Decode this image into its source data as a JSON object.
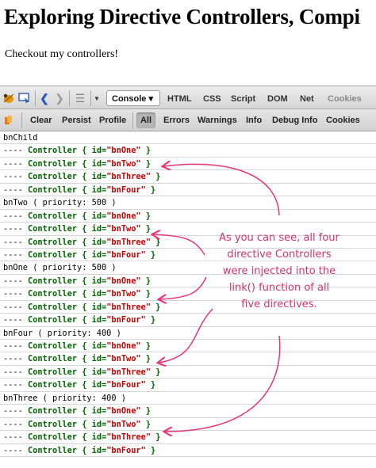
{
  "page": {
    "title": "Exploring Directive Controllers, Compi",
    "subtitle": "Checkout my controllers!"
  },
  "toolbar": {
    "console_tab": "Console ▾",
    "tabs": [
      "HTML",
      "CSS",
      "Script",
      "DOM",
      "Net",
      "Cookies"
    ]
  },
  "console_toolbar": {
    "buttons": [
      "Clear",
      "Persist",
      "Profile"
    ],
    "filters": [
      "All",
      "Errors",
      "Warnings",
      "Info",
      "Debug Info",
      "Cookies"
    ]
  },
  "log": [
    {
      "type": "header",
      "text": "bnChild"
    },
    {
      "type": "ctrl",
      "prefix": "----",
      "label": "Controller",
      "open": "{",
      "key": "id=",
      "value": "\"bnOne\"",
      "close": "}"
    },
    {
      "type": "ctrl",
      "prefix": "----",
      "label": "Controller",
      "open": "{",
      "key": "id=",
      "value": "\"bnTwo\"",
      "close": "}"
    },
    {
      "type": "ctrl",
      "prefix": "----",
      "label": "Controller",
      "open": "{",
      "key": "id=",
      "value": "\"bnThree\"",
      "close": "}"
    },
    {
      "type": "ctrl",
      "prefix": "----",
      "label": "Controller",
      "open": "{",
      "key": "id=",
      "value": "\"bnFour\"",
      "close": "}"
    },
    {
      "type": "header",
      "text": "bnTwo ( priority: 500 )"
    },
    {
      "type": "ctrl",
      "prefix": "----",
      "label": "Controller",
      "open": "{",
      "key": "id=",
      "value": "\"bnOne\"",
      "close": "}"
    },
    {
      "type": "ctrl",
      "prefix": "----",
      "label": "Controller",
      "open": "{",
      "key": "id=",
      "value": "\"bnTwo\"",
      "close": "}"
    },
    {
      "type": "ctrl",
      "prefix": "----",
      "label": "Controller",
      "open": "{",
      "key": "id=",
      "value": "\"bnThree\"",
      "close": "}"
    },
    {
      "type": "ctrl",
      "prefix": "----",
      "label": "Controller",
      "open": "{",
      "key": "id=",
      "value": "\"bnFour\"",
      "close": "}"
    },
    {
      "type": "header",
      "text": "bnOne ( priority: 500 )"
    },
    {
      "type": "ctrl",
      "prefix": "----",
      "label": "Controller",
      "open": "{",
      "key": "id=",
      "value": "\"bnOne\"",
      "close": "}"
    },
    {
      "type": "ctrl",
      "prefix": "----",
      "label": "Controller",
      "open": "{",
      "key": "id=",
      "value": "\"bnTwo\"",
      "close": "}"
    },
    {
      "type": "ctrl",
      "prefix": "----",
      "label": "Controller",
      "open": "{",
      "key": "id=",
      "value": "\"bnThree\"",
      "close": "}"
    },
    {
      "type": "ctrl",
      "prefix": "----",
      "label": "Controller",
      "open": "{",
      "key": "id=",
      "value": "\"bnFour\"",
      "close": "}"
    },
    {
      "type": "header",
      "text": "bnFour ( priority: 400 )"
    },
    {
      "type": "ctrl",
      "prefix": "----",
      "label": "Controller",
      "open": "{",
      "key": "id=",
      "value": "\"bnOne\"",
      "close": "}"
    },
    {
      "type": "ctrl",
      "prefix": "----",
      "label": "Controller",
      "open": "{",
      "key": "id=",
      "value": "\"bnTwo\"",
      "close": "}"
    },
    {
      "type": "ctrl",
      "prefix": "----",
      "label": "Controller",
      "open": "{",
      "key": "id=",
      "value": "\"bnThree\"",
      "close": "}"
    },
    {
      "type": "ctrl",
      "prefix": "----",
      "label": "Controller",
      "open": "{",
      "key": "id=",
      "value": "\"bnFour\"",
      "close": "}"
    },
    {
      "type": "header",
      "text": "bnThree ( priority: 400 )"
    },
    {
      "type": "ctrl",
      "prefix": "----",
      "label": "Controller",
      "open": "{",
      "key": "id=",
      "value": "\"bnOne\"",
      "close": "}"
    },
    {
      "type": "ctrl",
      "prefix": "----",
      "label": "Controller",
      "open": "{",
      "key": "id=",
      "value": "\"bnTwo\"",
      "close": "}"
    },
    {
      "type": "ctrl",
      "prefix": "----",
      "label": "Controller",
      "open": "{",
      "key": "id=",
      "value": "\"bnThree\"",
      "close": "}"
    },
    {
      "type": "ctrl",
      "prefix": "----",
      "label": "Controller",
      "open": "{",
      "key": "id=",
      "value": "\"bnFour\"",
      "close": "}"
    }
  ],
  "annotation": {
    "lines": [
      "As you can see, all four",
      "directive Controllers",
      "were injected into the",
      "link() function of all",
      "five directives."
    ],
    "color": "#d6336c"
  },
  "colors": {
    "controller_green": "#006400",
    "value_red": "#c80000"
  },
  "icons": [
    "firebug-icon",
    "inspect-icon",
    "back-icon",
    "forward-icon",
    "list-icon",
    "dropdown-icon",
    "clear-console-icon"
  ]
}
